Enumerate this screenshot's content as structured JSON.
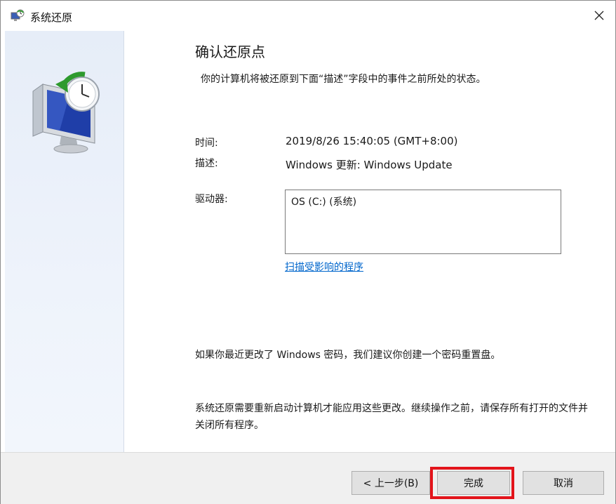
{
  "window": {
    "title": "系统还原",
    "icons": {
      "app": "system-restore-icon",
      "close": "close-icon",
      "hero": "computer-restore-icon"
    }
  },
  "content": {
    "heading": "确认还原点",
    "intro": "你的计算机将被还原到下面“描述”字段中的事件之前所处的状态。",
    "time_label": "时间:",
    "time_value": "2019/8/26 15:40:05 (GMT+8:00)",
    "desc_label": "描述:",
    "desc_value": "Windows 更新: Windows Update",
    "drive_label": "驱动器:",
    "drives": [
      "OS (C:) (系统)"
    ],
    "scan_link": "扫描受影响的程序",
    "password_note": "如果你最近更改了 Windows 密码，我们建议你创建一个密码重置盘。",
    "restart_note": "系统还原需要重新启动计算机才能应用这些更改。继续操作之前，请保存所有打开的文件并关闭所有程序。"
  },
  "footer": {
    "back_label": "< 上一步(B)",
    "finish_label": "完成",
    "cancel_label": "取消"
  },
  "colors": {
    "link": "#0066cc",
    "highlight": "#e3141b",
    "side_panel": "#e6edf8",
    "footer": "#f0f0f0"
  }
}
